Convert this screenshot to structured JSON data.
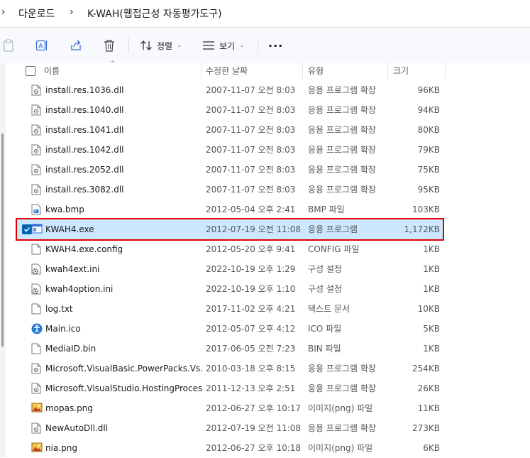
{
  "breadcrumb": {
    "items": [
      "다운로드",
      "K-WAH(웹접근성 자동평가도구)"
    ]
  },
  "toolbar": {
    "sort_label": "정렬",
    "view_label": "보기",
    "more_label": "···"
  },
  "columns": {
    "name": "이름",
    "date": "수정한 날짜",
    "type": "유형",
    "size": "크기"
  },
  "files": [
    {
      "name": "install.res.1036.dll",
      "date": "2007-11-07 오전 8:03",
      "type": "응용 프로그램 확장",
      "size": "96KB",
      "icon": "dll-icon"
    },
    {
      "name": "install.res.1040.dll",
      "date": "2007-11-07 오전 8:03",
      "type": "응용 프로그램 확장",
      "size": "94KB",
      "icon": "dll-icon"
    },
    {
      "name": "install.res.1041.dll",
      "date": "2007-11-07 오전 8:03",
      "type": "응용 프로그램 확장",
      "size": "80KB",
      "icon": "dll-icon"
    },
    {
      "name": "install.res.1042.dll",
      "date": "2007-11-07 오전 8:03",
      "type": "응용 프로그램 확장",
      "size": "79KB",
      "icon": "dll-icon"
    },
    {
      "name": "install.res.2052.dll",
      "date": "2007-11-07 오전 8:03",
      "type": "응용 프로그램 확장",
      "size": "75KB",
      "icon": "dll-icon"
    },
    {
      "name": "install.res.3082.dll",
      "date": "2007-11-07 오전 8:03",
      "type": "응용 프로그램 확장",
      "size": "95KB",
      "icon": "dll-icon"
    },
    {
      "name": "kwa.bmp",
      "date": "2012-05-04 오후 2:41",
      "type": "BMP 파일",
      "size": "103KB",
      "icon": "bmp-icon"
    },
    {
      "name": "KWAH4.exe",
      "date": "2012-07-19 오전 11:08",
      "type": "응용 프로그램",
      "size": "1,172KB",
      "icon": "exe-icon",
      "selected": true
    },
    {
      "name": "KWAH4.exe.config",
      "date": "2012-05-20 오후 9:41",
      "type": "CONFIG 파일",
      "size": "1KB",
      "icon": "file-icon"
    },
    {
      "name": "kwah4ext.ini",
      "date": "2022-10-19 오후 1:29",
      "type": "구성 설정",
      "size": "1KB",
      "icon": "ini-gear-icon"
    },
    {
      "name": "kwah4option.ini",
      "date": "2022-10-19 오후 1:10",
      "type": "구성 설정",
      "size": "1KB",
      "icon": "ini-gear-icon"
    },
    {
      "name": "log.txt",
      "date": "2017-11-02 오후 4:21",
      "type": "텍스트 문서",
      "size": "10KB",
      "icon": "file-icon"
    },
    {
      "name": "Main.ico",
      "date": "2012-05-07 오후 4:12",
      "type": "ICO 파일",
      "size": "5KB",
      "icon": "accessibility-icon"
    },
    {
      "name": "MediaID.bin",
      "date": "2017-06-05 오전 7:23",
      "type": "BIN 파일",
      "size": "1KB",
      "icon": "file-icon"
    },
    {
      "name": "Microsoft.VisualBasic.PowerPacks.Vs.dll",
      "date": "2010-03-18 오후 8:15",
      "type": "응용 프로그램 확장",
      "size": "254KB",
      "icon": "dll-icon"
    },
    {
      "name": "Microsoft.VisualStudio.HostingProces...",
      "date": "2011-12-13 오후 2:51",
      "type": "응용 프로그램 확장",
      "size": "26KB",
      "icon": "dll-icon"
    },
    {
      "name": "mopas.png",
      "date": "2012-06-27 오후 10:17",
      "type": "이미지(png) 파일",
      "size": "11KB",
      "icon": "png-icon"
    },
    {
      "name": "NewAutoDll.dll",
      "date": "2012-07-19 오전 11:08",
      "type": "응용 프로그램 확장",
      "size": "273KB",
      "icon": "dll-icon"
    },
    {
      "name": "nia.png",
      "date": "2012-06-27 오후 10:18",
      "type": "이미지(png) 파일",
      "size": "6KB",
      "icon": "png-icon"
    }
  ],
  "colors": {
    "selection": "#cce8ff",
    "highlight_border": "#e00000",
    "checkbox": "#0063b1"
  }
}
